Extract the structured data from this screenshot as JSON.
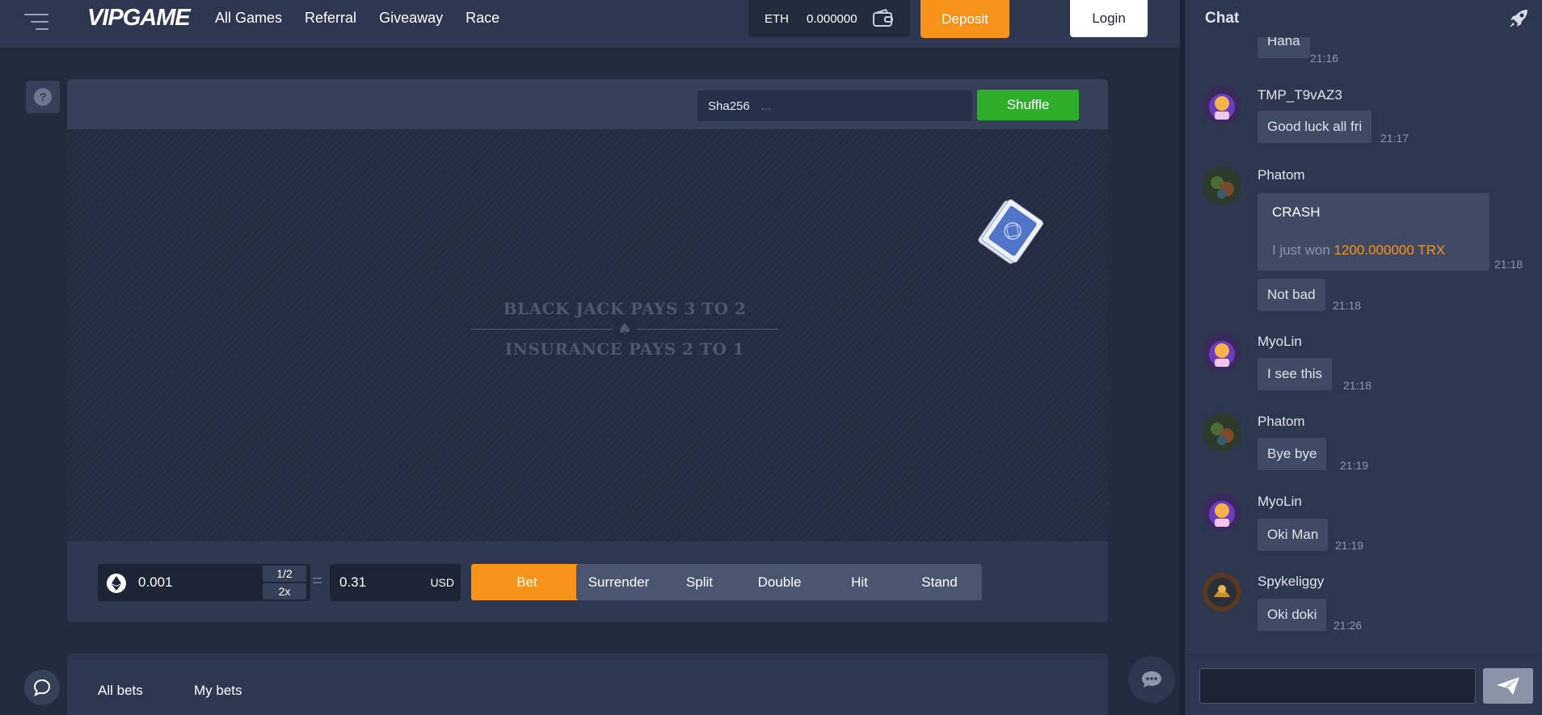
{
  "header": {
    "logo_text": "VIPGAME",
    "nav": [
      "All Games",
      "Referral",
      "Giveaway",
      "Race"
    ],
    "wallet_currency": "ETH",
    "wallet_balance": "0.000000",
    "deposit_label": "Deposit",
    "login_label": "Login"
  },
  "game": {
    "hash_label": "Sha256",
    "hash_value": "...",
    "shuffle_label": "Shuffle",
    "table_line1": "BLACK JACK PAYS 3 TO 2",
    "table_line2": "INSURANCE PAYS 2 TO 1",
    "bet_amount": "0.001",
    "half_label": "1/2",
    "double_amount_label": "2x",
    "usd_value": "0.31",
    "usd_currency": "USD",
    "bet_label": "Bet",
    "actions": [
      "Surrender",
      "Split",
      "Double",
      "Hit",
      "Stand"
    ]
  },
  "bets_tabs": [
    "All bets",
    "My bets"
  ],
  "chat": {
    "title": "Chat",
    "messages": [
      {
        "user": "",
        "text": "Hana",
        "time": "21:16"
      },
      {
        "user": "TMP_T9vAZ3",
        "text": "Good luck all fri",
        "time": "21:17"
      },
      {
        "user": "Phatom",
        "card_title": "CRASH",
        "card_prefix": "I just won",
        "card_amount": "1200.000000 TRX",
        "time": "21:18"
      },
      {
        "user": "",
        "text": "Not bad",
        "time": "21:18"
      },
      {
        "user": "MyoLin",
        "text": "I see this",
        "time": "21:18"
      },
      {
        "user": "Phatom",
        "text": "Bye bye",
        "time": "21:19"
      },
      {
        "user": "MyoLin",
        "text": "Oki Man",
        "time": "21:19"
      },
      {
        "user": "Spykeliggy",
        "text": "Oki doki",
        "time": "21:26"
      }
    ],
    "input_placeholder": ""
  },
  "colors": {
    "accent": "#f7931a",
    "shuffle_green": "#2fae2c",
    "panel": "#2d3750",
    "background": "#232b3e"
  }
}
